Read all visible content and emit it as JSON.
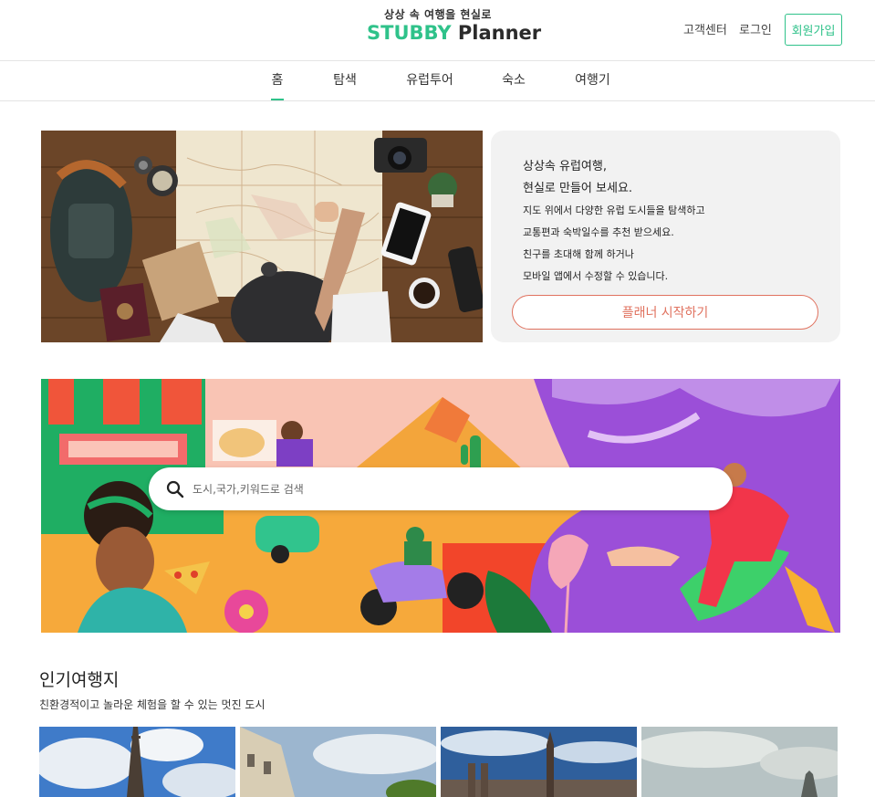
{
  "header": {
    "tagline": "상상 속 여행을 현실로",
    "brand_1": "STUBBY",
    "brand_2": "Planner",
    "help_label": "고객센터",
    "login_label": "로그인",
    "signup_label": "회원가입"
  },
  "nav": {
    "items": [
      {
        "label": "홈",
        "active": true
      },
      {
        "label": "탐색",
        "active": false
      },
      {
        "label": "유럽투어",
        "active": false
      },
      {
        "label": "숙소",
        "active": false
      },
      {
        "label": "여행기",
        "active": false
      }
    ]
  },
  "hero": {
    "title_1": "상상속 유럽여행,",
    "title_2": "현실로 만들어 보세요.",
    "lines": [
      "지도 위에서 다양한 유럽 도시들을 탐색하고",
      "교통편과 숙박일수를 추천 받으세요.",
      "친구를 초대해 함께 하거나",
      "모바일 앱에서 수정할 수 있습니다."
    ],
    "cta_label": "플래너 시작하기"
  },
  "search": {
    "placeholder": "도시,국가,키워드로 검색"
  },
  "popular": {
    "title": "인기여행지",
    "subtitle": "친환경적이고 놀라운 체험을 할 수 있는 멋진 도시"
  },
  "colors": {
    "brand_green": "#2fc28a",
    "cta_coral": "#e0725f"
  }
}
